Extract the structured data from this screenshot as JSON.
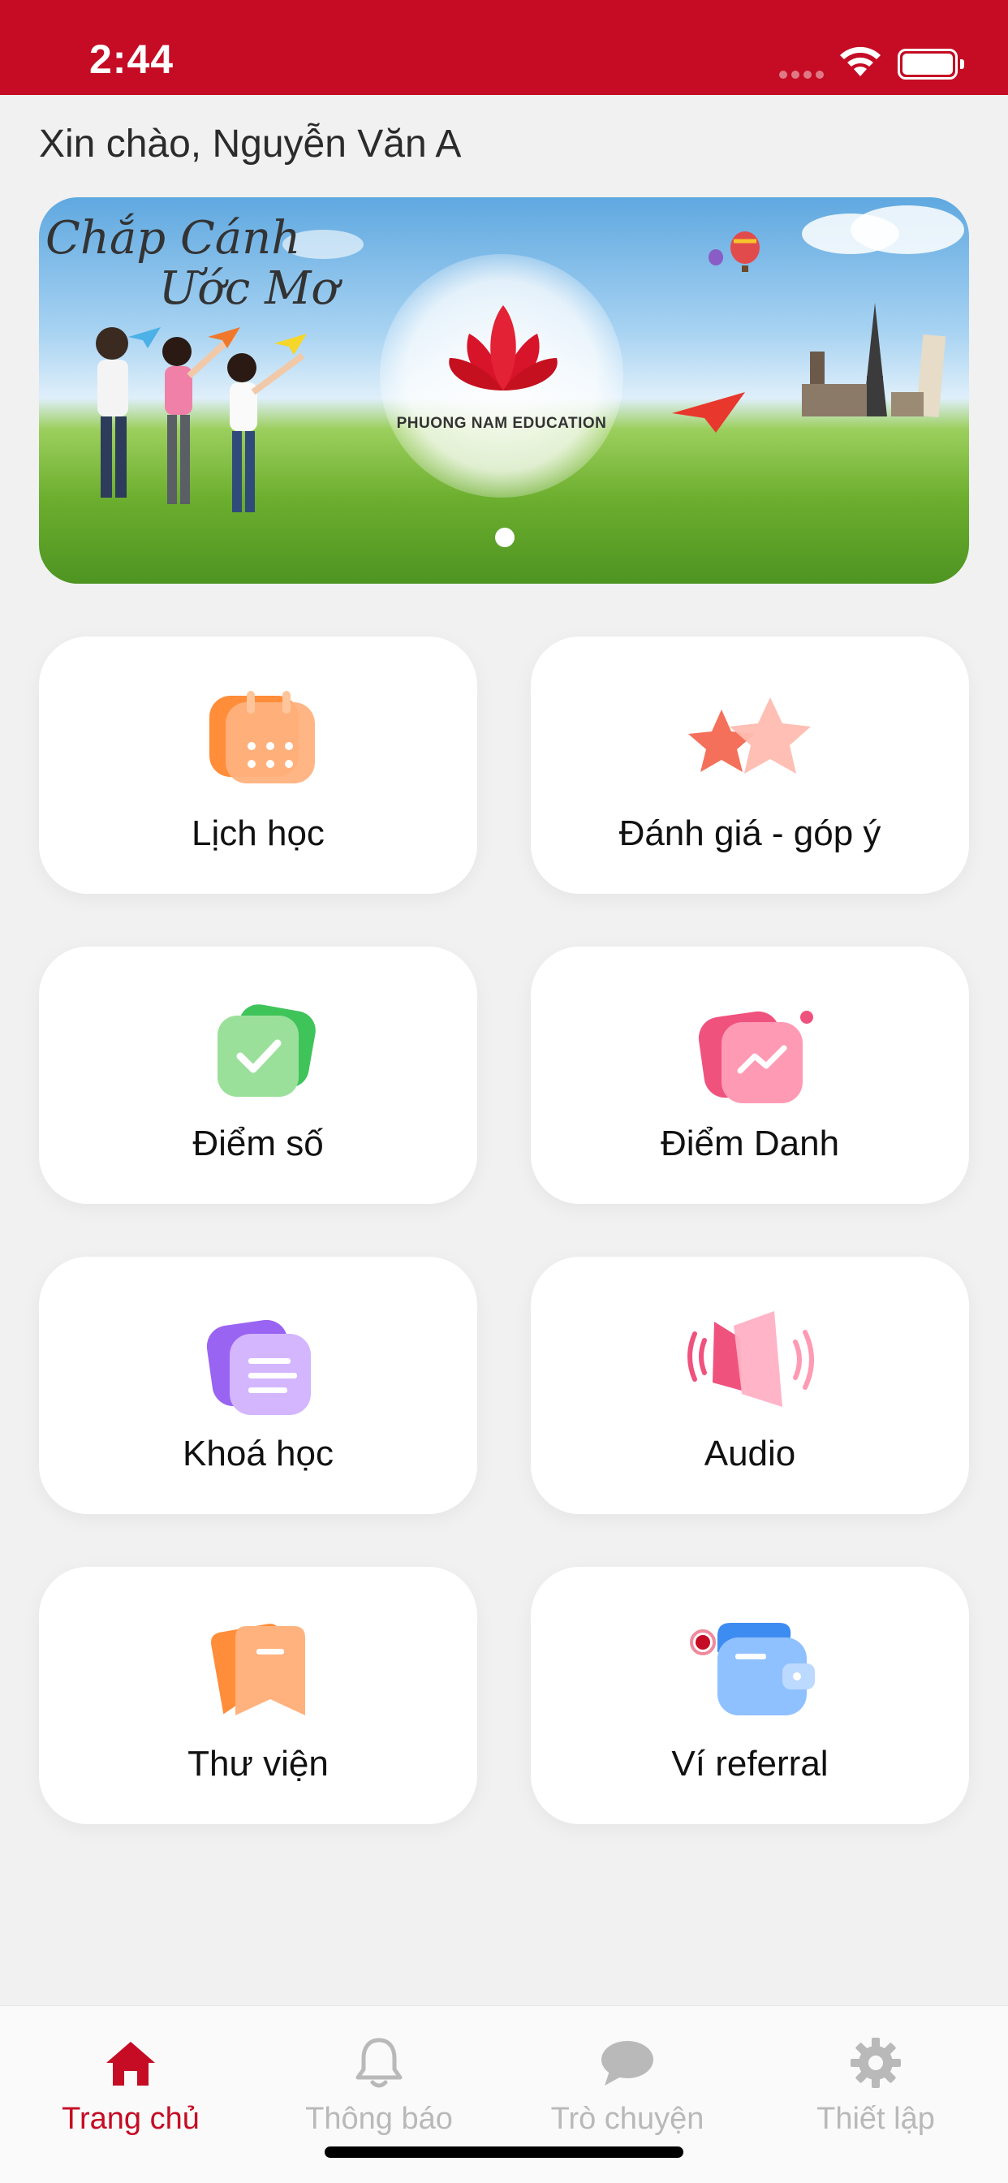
{
  "status": {
    "time": "2:44"
  },
  "greeting": "Xin chào, Nguyễn Văn A",
  "banner": {
    "script_line1": "Chắp Cánh",
    "script_line2": "Ước Mơ",
    "logo_text": "PHUONG NAM EDUCATION"
  },
  "tiles": [
    {
      "label": "Lịch học",
      "icon": "calendar-icon"
    },
    {
      "label": "Đánh giá - góp ý",
      "icon": "stars-icon"
    },
    {
      "label": "Điểm số",
      "icon": "check-icon"
    },
    {
      "label": "Điểm Danh",
      "icon": "chart-icon"
    },
    {
      "label": "Khoá học",
      "icon": "document-icon"
    },
    {
      "label": "Audio",
      "icon": "speaker-icon"
    },
    {
      "label": "Thư viện",
      "icon": "bookmark-icon"
    },
    {
      "label": "Ví referral",
      "icon": "wallet-icon"
    }
  ],
  "tabbar": {
    "home": "Trang chủ",
    "notifications": "Thông báo",
    "chat": "Trò chuyện",
    "settings": "Thiết lập"
  },
  "colors": {
    "brand": "#c50c24",
    "inactive": "#b9b9b9"
  }
}
